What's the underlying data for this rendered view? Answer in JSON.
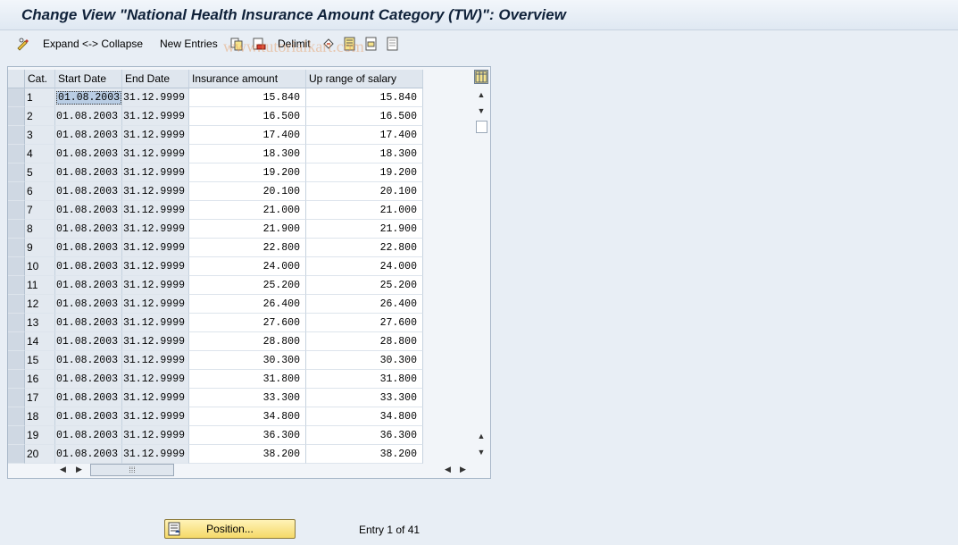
{
  "title": "Change View \"National Health Insurance Amount Category (TW)\": Overview",
  "toolbar": {
    "expand_collapse": "Expand <-> Collapse",
    "new_entries": "New Entries",
    "delimit": "Delimit"
  },
  "watermark": "www.tutorialkart.com",
  "table": {
    "headers": {
      "cat": "Cat.",
      "start": "Start Date",
      "end": "End Date",
      "insurance": "Insurance amount",
      "up_range": "Up range of salary"
    },
    "rows": [
      {
        "cat": "1",
        "start": "01.08.2003",
        "end": "31.12.9999",
        "insurance": "15.840",
        "up_range": "15.840"
      },
      {
        "cat": "2",
        "start": "01.08.2003",
        "end": "31.12.9999",
        "insurance": "16.500",
        "up_range": "16.500"
      },
      {
        "cat": "3",
        "start": "01.08.2003",
        "end": "31.12.9999",
        "insurance": "17.400",
        "up_range": "17.400"
      },
      {
        "cat": "4",
        "start": "01.08.2003",
        "end": "31.12.9999",
        "insurance": "18.300",
        "up_range": "18.300"
      },
      {
        "cat": "5",
        "start": "01.08.2003",
        "end": "31.12.9999",
        "insurance": "19.200",
        "up_range": "19.200"
      },
      {
        "cat": "6",
        "start": "01.08.2003",
        "end": "31.12.9999",
        "insurance": "20.100",
        "up_range": "20.100"
      },
      {
        "cat": "7",
        "start": "01.08.2003",
        "end": "31.12.9999",
        "insurance": "21.000",
        "up_range": "21.000"
      },
      {
        "cat": "8",
        "start": "01.08.2003",
        "end": "31.12.9999",
        "insurance": "21.900",
        "up_range": "21.900"
      },
      {
        "cat": "9",
        "start": "01.08.2003",
        "end": "31.12.9999",
        "insurance": "22.800",
        "up_range": "22.800"
      },
      {
        "cat": "10",
        "start": "01.08.2003",
        "end": "31.12.9999",
        "insurance": "24.000",
        "up_range": "24.000"
      },
      {
        "cat": "11",
        "start": "01.08.2003",
        "end": "31.12.9999",
        "insurance": "25.200",
        "up_range": "25.200"
      },
      {
        "cat": "12",
        "start": "01.08.2003",
        "end": "31.12.9999",
        "insurance": "26.400",
        "up_range": "26.400"
      },
      {
        "cat": "13",
        "start": "01.08.2003",
        "end": "31.12.9999",
        "insurance": "27.600",
        "up_range": "27.600"
      },
      {
        "cat": "14",
        "start": "01.08.2003",
        "end": "31.12.9999",
        "insurance": "28.800",
        "up_range": "28.800"
      },
      {
        "cat": "15",
        "start": "01.08.2003",
        "end": "31.12.9999",
        "insurance": "30.300",
        "up_range": "30.300"
      },
      {
        "cat": "16",
        "start": "01.08.2003",
        "end": "31.12.9999",
        "insurance": "31.800",
        "up_range": "31.800"
      },
      {
        "cat": "17",
        "start": "01.08.2003",
        "end": "31.12.9999",
        "insurance": "33.300",
        "up_range": "33.300"
      },
      {
        "cat": "18",
        "start": "01.08.2003",
        "end": "31.12.9999",
        "insurance": "34.800",
        "up_range": "34.800"
      },
      {
        "cat": "19",
        "start": "01.08.2003",
        "end": "31.12.9999",
        "insurance": "36.300",
        "up_range": "36.300"
      },
      {
        "cat": "20",
        "start": "01.08.2003",
        "end": "31.12.9999",
        "insurance": "38.200",
        "up_range": "38.200"
      }
    ]
  },
  "footer": {
    "position_label": "Position...",
    "entry_info": "Entry 1 of 41"
  },
  "icons": {
    "toolbar": [
      "pencil-glasses-icon",
      "copy-icon",
      "delete-icon",
      "undo-icon",
      "select-all-icon",
      "select-block-icon",
      "deselect-all-icon"
    ],
    "table": [
      "table-settings-icon"
    ],
    "footer": [
      "position-icon"
    ]
  },
  "colors": {
    "background": "#e8eef5",
    "title": "#10223a",
    "position_button": "#f5d968"
  }
}
